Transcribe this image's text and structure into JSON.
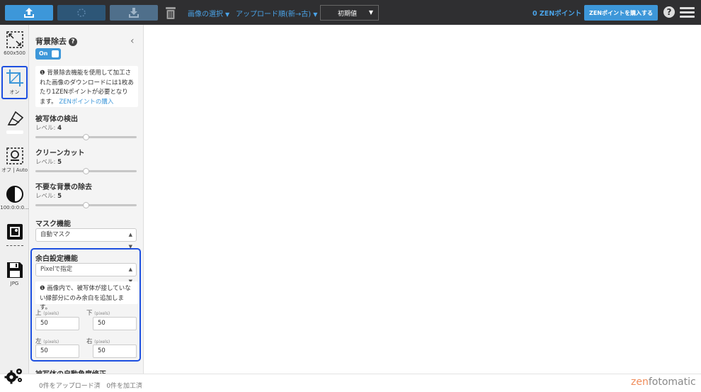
{
  "header": {
    "select_images_label": "画像の選択",
    "sort_label": "アップロード順(新→古)",
    "preset_select_value": "初期値",
    "points_label": "0 ZENポイント",
    "buy_points_label": "ZENポイントを購入する",
    "help_glyph": "?"
  },
  "tools": {
    "size": "600x500",
    "crop": "オン",
    "shadow": "オフ | Auto",
    "adjust": "100:0:0:0...",
    "format": "JPG"
  },
  "panel": {
    "bg_removal_title": "背景除去",
    "help_glyph": "?",
    "collapse_glyph": "‹",
    "toggle_label": "On",
    "info_text": "背景除去機能を使用して加工された画像のダウンロードには1枚あたり1ZENポイントが必要となります。",
    "info_link": "ZENポイントの購入",
    "subject_detect": {
      "title": "被写体の検出",
      "level_label": "レベル:",
      "level": "4",
      "level_fraction": 0.5
    },
    "clean_cut": {
      "title": "クリーンカット",
      "level_label": "レベル:",
      "level": "5",
      "level_fraction": 0.5
    },
    "unwanted_bg": {
      "title": "不要な背景の除去",
      "level_label": "レベル:",
      "level": "5",
      "level_fraction": 0.5
    },
    "mask": {
      "title": "マスク機能",
      "value": "自動マスク"
    },
    "margin": {
      "title": "余白設定機能",
      "mode": "Pixelで指定",
      "info_text": "画像内で、被写体が接していない縁部分にのみ余白を追加します。",
      "top_label": "上",
      "bottom_label": "下",
      "left_label": "左",
      "right_label": "右",
      "unit_label": "(pixels)",
      "top": "50",
      "bottom": "50",
      "left": "50",
      "right": "50"
    },
    "auto_angle_title": "被写体の自動角度修正"
  },
  "status": {
    "uploaded": "0件をアップロード済",
    "processed": "0件を加工済"
  },
  "brand": {
    "prefix": "zen",
    "suffix": "fotomatic"
  },
  "colors": {
    "accent": "#3d97d9",
    "highlight": "#1d4fe0",
    "topbar": "#2f2f31",
    "brand_orange": "#f08c5a"
  }
}
